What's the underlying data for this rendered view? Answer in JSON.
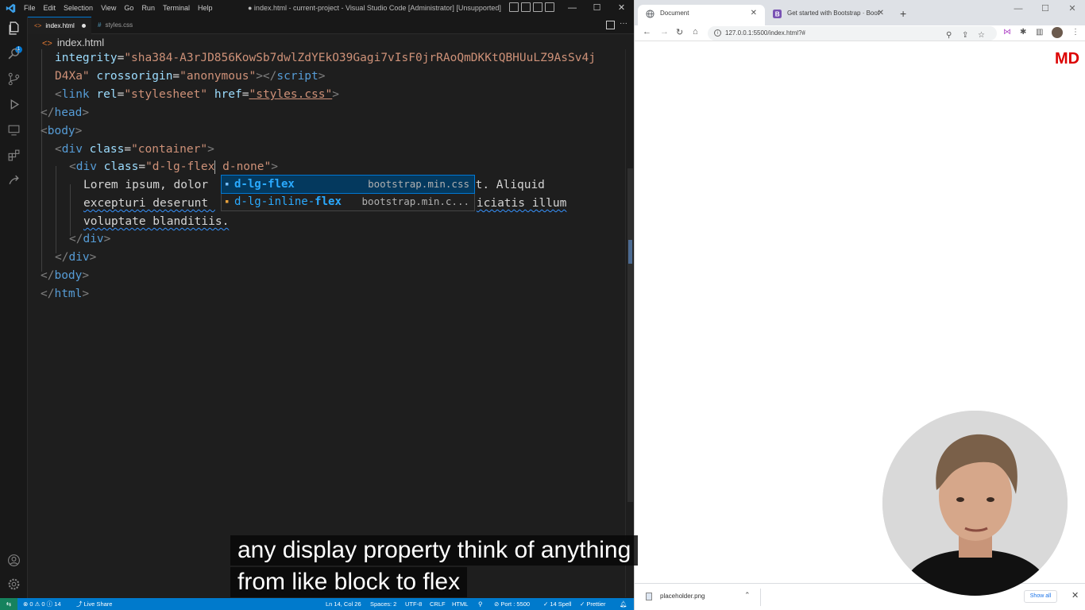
{
  "vscode": {
    "menu": [
      "File",
      "Edit",
      "Selection",
      "View",
      "Go",
      "Run",
      "Terminal",
      "Help"
    ],
    "window_title": "● index.html - current-project - Visual Studio Code [Administrator] [Unsupported]",
    "window_controls": [
      "—",
      "☐",
      "✕"
    ],
    "explorer_badge": "1",
    "tabs": [
      {
        "label": "index.html",
        "modified": true,
        "active": true
      },
      {
        "label": "styles.css",
        "modified": false,
        "active": false
      }
    ],
    "breadcrumb": "index.html",
    "code": {
      "l1_attr": "integrity",
      "l1_value": "\"sha384-A3rJD856KowSb7dwlZdYEkO39Gagi7vIsF0jrRAoQmDKKtQBHUuLZ9AsSv4j",
      "l2_value": "D4Xa\"",
      "l2_attr": "crossorigin",
      "l2_attr_value": "\"anonymous\"",
      "l2_close": "></",
      "l2_tag": "script",
      "l2_end": ">",
      "l3_open": "<",
      "l3_tag": "link",
      "l3_attr1": "rel",
      "l3_val1": "\"stylesheet\"",
      "l3_attr2": "href",
      "l3_val2": "\"styles.css\"",
      "l3_end": ">",
      "head_close": "head",
      "body_open": "body",
      "div_tag": "div",
      "class_attr": "class",
      "container_value": "\"container\"",
      "dlg_value_start": "\"d-lg-flex",
      "dlg_value_end": " d-none\"",
      "lorem_1a": "Lorem ipsum, dolor ",
      "lorem_1b": "it. Aliquid",
      "lorem_2a": "excepturi deserunt ",
      "lorem_2b": "iciatis illum",
      "lorem_3": "voluptate blanditiis.",
      "div_close": "div",
      "body_close": "body",
      "html_close": "html"
    },
    "suggestions": [
      {
        "prefix": "",
        "match": "d-lg-flex",
        "suffix": "",
        "source": "bootstrap.min.css"
      },
      {
        "prefix": "d-lg-inline-",
        "match": "flex",
        "suffix": "",
        "source": "bootstrap.min.c..."
      }
    ],
    "statusbar": {
      "problems": "⊗ 0 ⚠ 0 ⓘ 14",
      "live_share": "Live Share",
      "position": "Ln 14, Col 26",
      "spaces": "Spaces: 2",
      "encoding": "UTF-8",
      "eol": "CRLF",
      "language": "HTML",
      "port": "Port : 5500",
      "spell": "14 Spell",
      "prettier": "✓ Prettier"
    }
  },
  "browser": {
    "tabs": [
      {
        "title": "Document",
        "active": true
      },
      {
        "title": "Get started with Bootstrap · Boot",
        "active": false
      }
    ],
    "window_controls": [
      "—",
      "☐",
      "✕"
    ],
    "url": "127.0.0.1:5500/index.html?#",
    "page_text": "MD",
    "download": {
      "filename": "placeholder.png",
      "show_all": "Show all"
    }
  },
  "subtitles": {
    "line1": "any display property think of anything",
    "line2": "from like block to flex"
  },
  "colors": {
    "statusbar": "#007acc",
    "accent": "#0078d4",
    "page_text": "#dc0000"
  }
}
